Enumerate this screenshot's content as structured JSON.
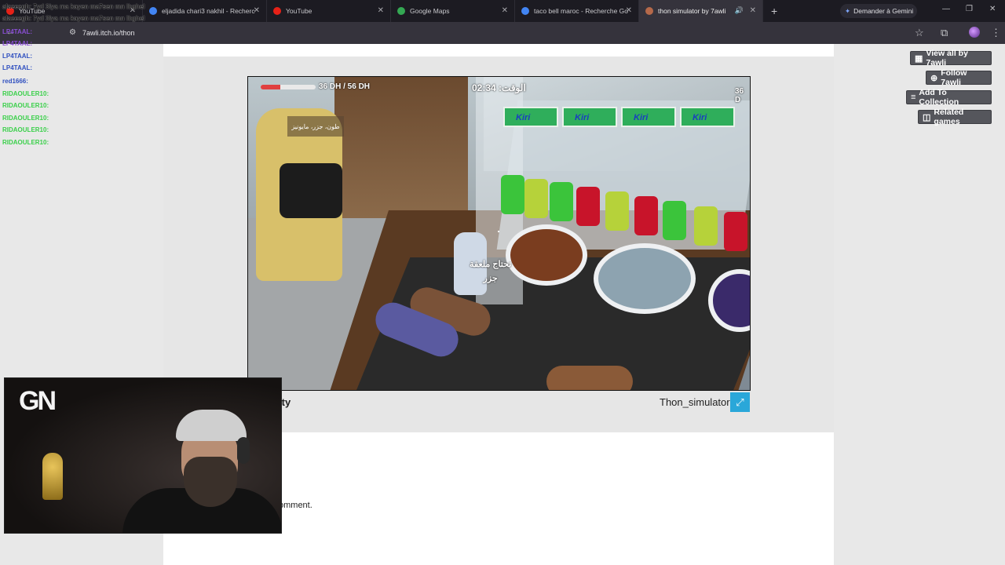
{
  "browser": {
    "tabs": [
      {
        "title": "YouTube",
        "favicon_color": "#e62117",
        "active": false
      },
      {
        "title": "eljadida chari3 nakhil - Recherc",
        "favicon_color": "#4285f4",
        "active": false
      },
      {
        "title": "YouTube",
        "favicon_color": "#e62117",
        "active": false
      },
      {
        "title": "Google Maps",
        "favicon_color": "#34a853",
        "active": false
      },
      {
        "title": "taco bell maroc - Recherche Go",
        "favicon_color": "#4285f4",
        "active": false
      },
      {
        "title": "thon simulator by 7awli",
        "favicon_color": "#b5694a",
        "active": true
      }
    ],
    "new_tab": "+",
    "gemini_label": "Demander à Gemini",
    "url": "7awli.itch.io/thon"
  },
  "game": {
    "money": "36 DH / 56 DH",
    "money_right": "36 D",
    "time": "الوقت: 02:34",
    "order": "طون، جزر، مايونيز",
    "prompt_line1": "تحتاج ملعقة",
    "prompt_line2": "جزر",
    "health_fraction": 0.35,
    "kiri_label": "Kiri"
  },
  "embed": {
    "title": "Thon_simulator",
    "engine_partial": "ity",
    "fullscreen_icon": "expand-icon"
  },
  "comment_partial": "omment.",
  "actions": {
    "view_all": "View all by 7awli",
    "follow": "Follow 7awli",
    "add_collection": "Add To Collection",
    "related": "Related games"
  },
  "chat": [
    {
      "user": "alaeeegh",
      "text": "alaeeegh: 7yd 3lya ma kayen ma7sen mn lbghel",
      "color": "white"
    },
    {
      "user": "alaeeegh",
      "text": "alaeeegh: 7yd 3lya ma kayen ma7sen mn lbghel",
      "color": "white"
    },
    {
      "user": "LP4TAAL",
      "text": "LP4TAAL:",
      "color": "purple"
    },
    {
      "user": "LP4TAAL",
      "text": "LP4TAAL:",
      "color": "purple"
    },
    {
      "user": "LP4TAAL",
      "text": "LP4TAAL:",
      "color": "blue"
    },
    {
      "user": "LP4TAAL",
      "text": "LP4TAAL:",
      "color": "blue"
    },
    {
      "user": "red1666",
      "text": "red1666:",
      "color": "blue"
    },
    {
      "user": "RIDAOULER10",
      "text": "RIDAOULER10:",
      "color": "green"
    },
    {
      "user": "RIDAOULER10",
      "text": "RIDAOULER10:",
      "color": "green"
    },
    {
      "user": "RIDAOULER10",
      "text": "RIDAOULER10:",
      "color": "green"
    },
    {
      "user": "RIDAOULER10",
      "text": "RIDAOULER10:",
      "color": "green"
    },
    {
      "user": "RIDAOULER10",
      "text": "RIDAOULER10:",
      "color": "green"
    }
  ],
  "webcam": {
    "logo": "GN"
  }
}
